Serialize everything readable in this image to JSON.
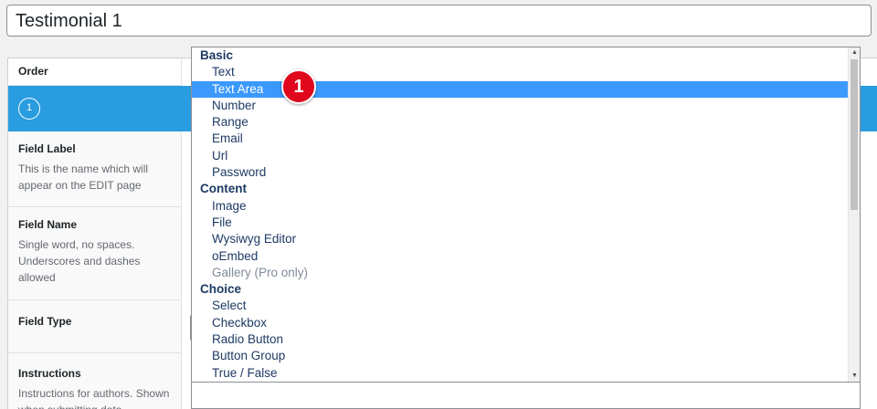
{
  "title_input": {
    "value": "Testimonial 1"
  },
  "order": {
    "header": "Order",
    "number": "1"
  },
  "sections": {
    "field_label": {
      "title": "Field Label",
      "desc": "This is the name which will appear on the EDIT page"
    },
    "field_name": {
      "title": "Field Name",
      "desc": "Single word, no spaces. Underscores and dashes allowed"
    },
    "field_type": {
      "title": "Field Type"
    },
    "instructions": {
      "title": "Instructions",
      "desc": "Instructions for authors. Shown when submitting data"
    }
  },
  "dropdown": {
    "groups": [
      {
        "label": "Basic",
        "options": [
          {
            "label": "Text"
          },
          {
            "label": "Text Area",
            "selected": true
          },
          {
            "label": "Number"
          },
          {
            "label": "Range"
          },
          {
            "label": "Email"
          },
          {
            "label": "Url"
          },
          {
            "label": "Password"
          }
        ]
      },
      {
        "label": "Content",
        "options": [
          {
            "label": "Image"
          },
          {
            "label": "File"
          },
          {
            "label": "Wysiwyg Editor"
          },
          {
            "label": "oEmbed"
          },
          {
            "label": "Gallery (Pro only)",
            "disabled": true
          }
        ]
      },
      {
        "label": "Choice",
        "options": [
          {
            "label": "Select"
          },
          {
            "label": "Checkbox"
          },
          {
            "label": "Radio Button"
          },
          {
            "label": "Button Group"
          },
          {
            "label": "True / False"
          }
        ]
      }
    ]
  },
  "badge": {
    "number": "1"
  },
  "colors": {
    "accent": "#2a9ce0",
    "selected": "#3b99fc",
    "badge": "#e0061b"
  },
  "icons": {
    "scroll_up": "triangle-up",
    "scroll_down": "triangle-down"
  }
}
